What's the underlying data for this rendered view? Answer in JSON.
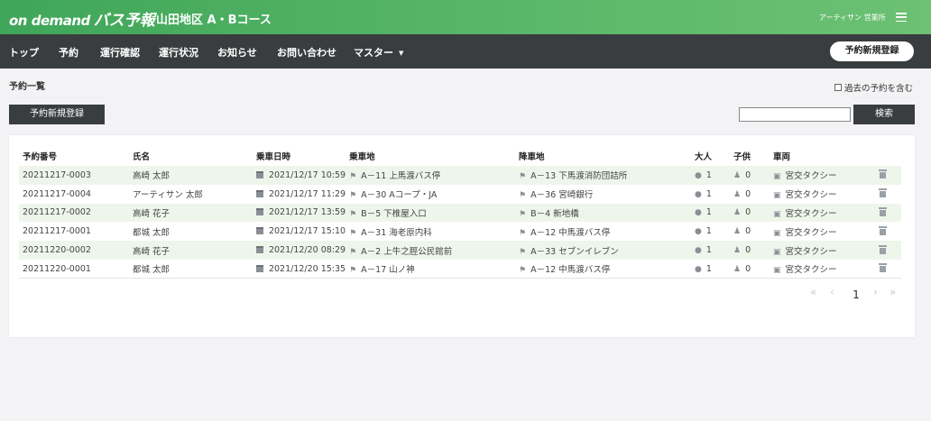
{
  "header": {
    "logo_latin": "on demand",
    "logo_jp": "バス予報",
    "route": "山田地区 A・Bコース",
    "user": "アーティサン 営業所"
  },
  "nav": {
    "items": [
      "トップ",
      "予約",
      "運行確認",
      "運行状況",
      "お知らせ",
      "お問い合わせ",
      "マスター"
    ],
    "new_button": "予約新規登録"
  },
  "page": {
    "title": "予約一覧",
    "past_label": "過去の予約を含む",
    "new_button": "予約新規登録",
    "search_button": "検索",
    "search_value": ""
  },
  "table": {
    "headers": [
      "予約番号",
      "氏名",
      "乗車日時",
      "乗車地",
      "降車地",
      "大人",
      "子供",
      "車両",
      ""
    ],
    "rows": [
      {
        "id": "20211217-0003",
        "name": "高崎 太郎",
        "datetime": "2021/12/17 10:59",
        "pickup": "A－11 上馬渡バス停",
        "dropoff": "A－13 下馬渡消防団詰所",
        "adult": "1",
        "child": "0",
        "vehicle": "宮交タクシー"
      },
      {
        "id": "20211217-0004",
        "name": "アーティサン 太郎",
        "datetime": "2021/12/17 11:29",
        "pickup": "A－30 Aコープ・JA",
        "dropoff": "A－36 宮崎銀行",
        "adult": "1",
        "child": "0",
        "vehicle": "宮交タクシー"
      },
      {
        "id": "20211217-0002",
        "name": "高崎 花子",
        "datetime": "2021/12/17 13:59",
        "pickup": "B－5 下椎屋入口",
        "dropoff": "B－4 新地橋",
        "adult": "1",
        "child": "0",
        "vehicle": "宮交タクシー"
      },
      {
        "id": "20211217-0001",
        "name": "都城 太郎",
        "datetime": "2021/12/17 15:10",
        "pickup": "A－31 海老原内科",
        "dropoff": "A－12 中馬渡バス停",
        "adult": "1",
        "child": "0",
        "vehicle": "宮交タクシー"
      },
      {
        "id": "20211220-0002",
        "name": "高崎 花子",
        "datetime": "2021/12/20 08:29",
        "pickup": "A－2 上牛之脛公民館前",
        "dropoff": "A－33 セブンイレブン",
        "adult": "1",
        "child": "0",
        "vehicle": "宮交タクシー"
      },
      {
        "id": "20211220-0001",
        "name": "都城 太郎",
        "datetime": "2021/12/20 15:35",
        "pickup": "A－17 山ノ神",
        "dropoff": "A－12 中馬渡バス停",
        "adult": "1",
        "child": "0",
        "vehicle": "宮交タクシー"
      }
    ]
  },
  "pagination": {
    "first": "«",
    "prev": "‹",
    "current": "1",
    "next": "›",
    "last": "»"
  },
  "colors": {
    "header_green": "#4daf5f",
    "nav_dark": "#3a3d3f",
    "row_stripe": "#eef6ec"
  }
}
